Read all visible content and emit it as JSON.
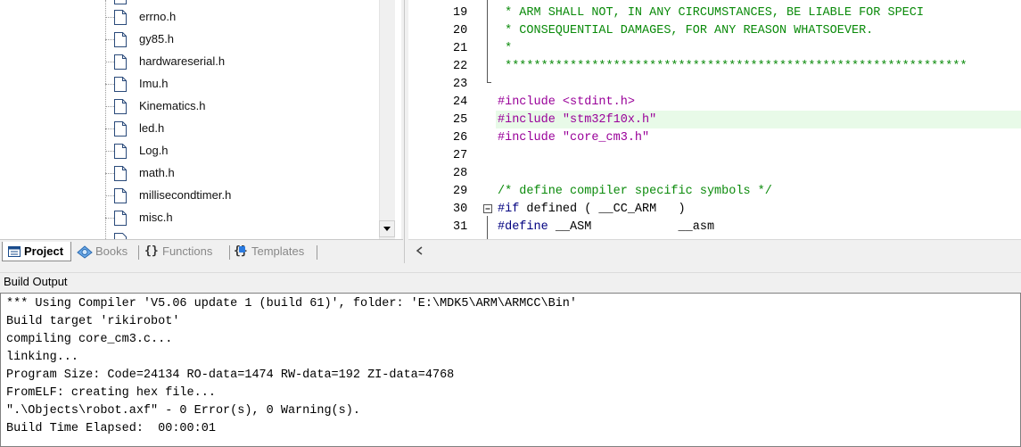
{
  "project_tree": {
    "files": [
      {
        "name": "errno.h"
      },
      {
        "name": "gy85.h"
      },
      {
        "name": "hardwareserial.h"
      },
      {
        "name": "Imu.h"
      },
      {
        "name": "Kinematics.h"
      },
      {
        "name": "led.h"
      },
      {
        "name": "Log.h"
      },
      {
        "name": "math.h"
      },
      {
        "name": "millisecondtimer.h"
      },
      {
        "name": "misc.h"
      }
    ]
  },
  "tabs": [
    {
      "label": "Project",
      "icon": "project-icon",
      "active": true
    },
    {
      "label": "Books",
      "icon": "books-icon",
      "active": false
    },
    {
      "label": "Functions",
      "icon": "functions-icon",
      "active": false
    },
    {
      "label": "Templates",
      "icon": "templates-icon",
      "active": false
    }
  ],
  "editor": {
    "lines": [
      {
        "num": "19",
        "text": " * ARM SHALL NOT, IN ANY CIRCUMSTANCES, BE LIABLE FOR SPECI",
        "kind": "comment"
      },
      {
        "num": "20",
        "text": " * CONSEQUENTIAL DAMAGES, FOR ANY REASON WHATSOEVER.",
        "kind": "comment"
      },
      {
        "num": "21",
        "text": " *",
        "kind": "comment"
      },
      {
        "num": "22",
        "text": " ****************************************************************",
        "kind": "comment"
      },
      {
        "num": "23",
        "text": "",
        "kind": "plain"
      },
      {
        "num": "24",
        "text": "#include <stdint.h>",
        "kind": "pre"
      },
      {
        "num": "25",
        "text": "#include \"stm32f10x.h\"",
        "kind": "pre"
      },
      {
        "num": "26",
        "text": "#include \"core_cm3.h\"",
        "kind": "pre"
      },
      {
        "num": "27",
        "text": "",
        "kind": "plain"
      },
      {
        "num": "28",
        "text": "",
        "kind": "plain"
      },
      {
        "num": "29",
        "text": "/* define compiler specific symbols */",
        "kind": "comment"
      },
      {
        "num": "30",
        "text": "#if defined ( __CC_ARM   )",
        "kind": "kw"
      },
      {
        "num": "31",
        "text": "#define __ASM            __asm",
        "kind": "kw"
      }
    ],
    "highlighted_line": "25"
  },
  "build_output": {
    "title": "Build Output",
    "lines": [
      "*** Using Compiler 'V5.06 update 1 (build 61)', folder: 'E:\\MDK5\\ARM\\ARMCC\\Bin'",
      "Build target 'rikirobot'",
      "compiling core_cm3.c...",
      "linking...",
      "Program Size: Code=24134 RO-data=1474 RW-data=192 ZI-data=4768",
      "FromELF: creating hex file...",
      "\".\\Objects\\robot.axf\" - 0 Error(s), 0 Warning(s).",
      "Build Time Elapsed:  00:00:01"
    ]
  },
  "colors": {
    "comment": "#0a8a0a",
    "preprocessor": "#990099",
    "keyword": "#000080",
    "highlight": "#e8fae8"
  }
}
